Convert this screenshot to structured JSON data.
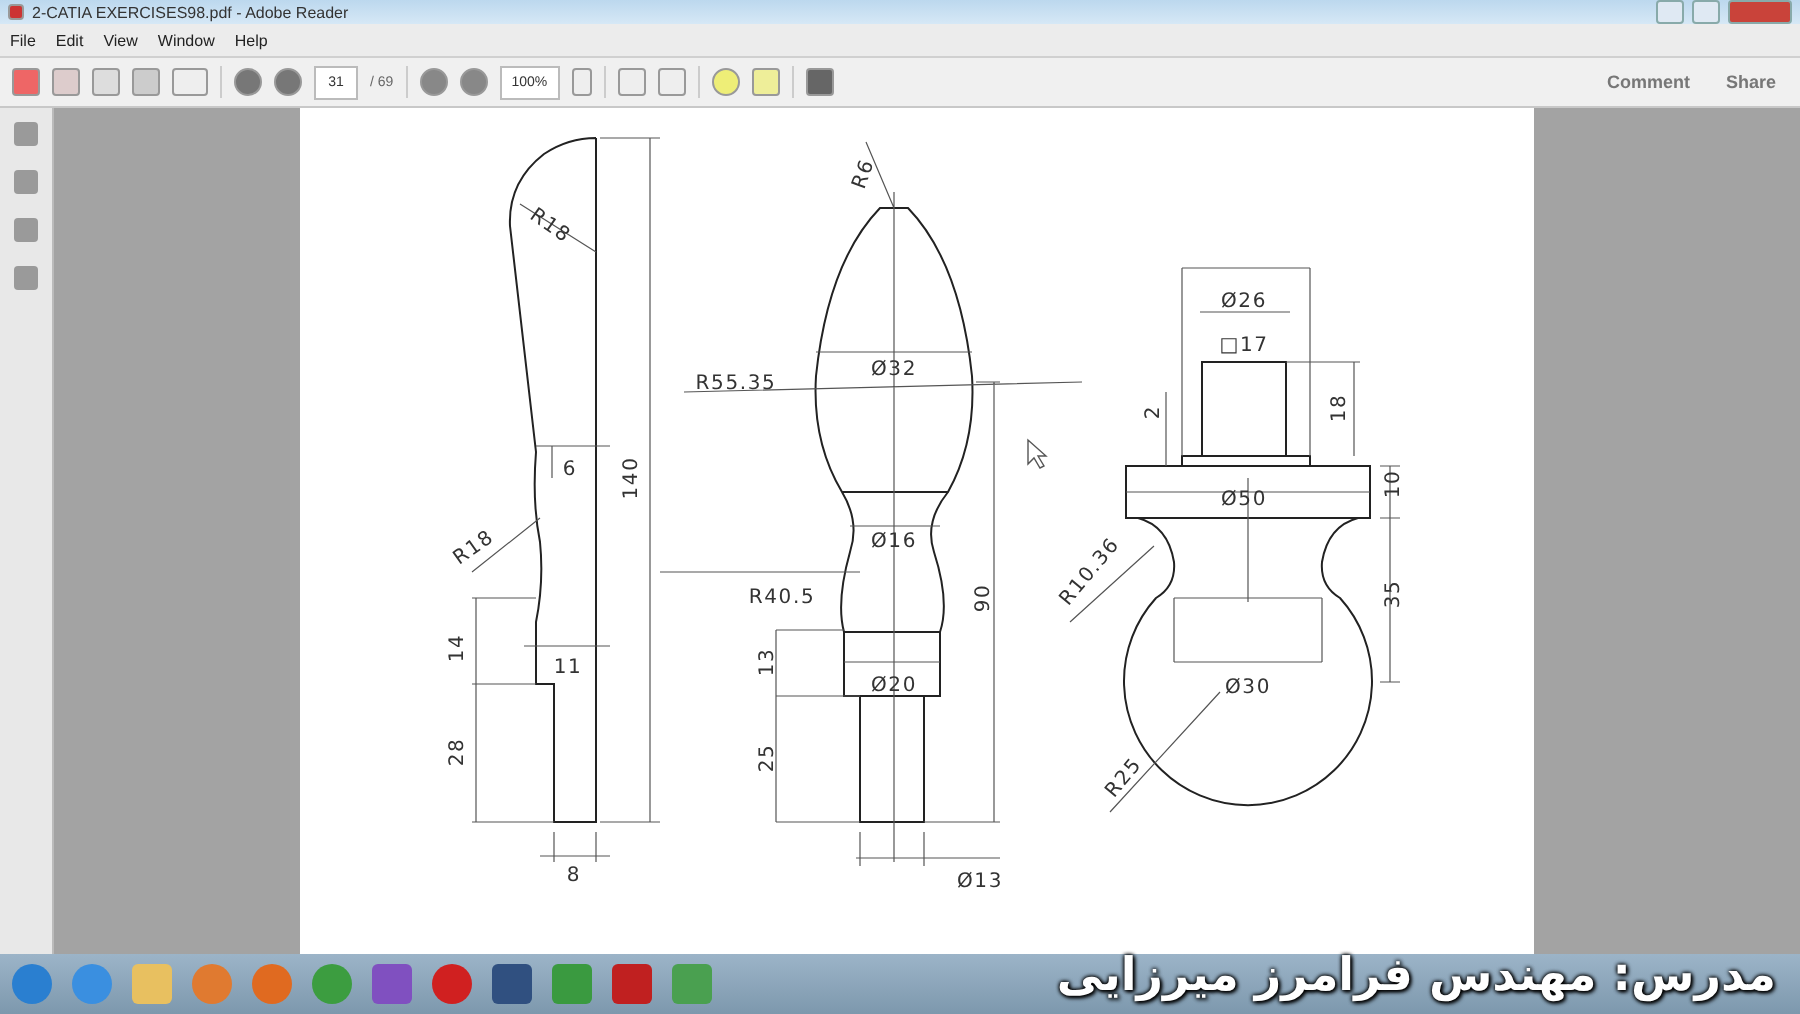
{
  "window": {
    "title": "2-CATIA EXERCISES98.pdf - Adobe Reader"
  },
  "menu": [
    "File",
    "Edit",
    "View",
    "Window",
    "Help"
  ],
  "toolbar": {
    "page": "31",
    "page_count": "/ 69",
    "zoom": "100%",
    "actions": [
      "Comment",
      "Share"
    ]
  },
  "drawing": {
    "labels": [
      "R18",
      "6",
      "140",
      "R18",
      "14",
      "11",
      "28",
      "8",
      "R6",
      "R55.35",
      "Ø32",
      "Ø16",
      "R40.5",
      "13",
      "Ø20",
      "25",
      "90",
      "Ø13",
      "Ø26",
      "□17",
      "2",
      "18",
      "Ø50",
      "10",
      "R10.36",
      "35",
      "Ø30",
      "R25"
    ]
  },
  "caption": "مدرس: مهندس فرامرز میرزایی"
}
